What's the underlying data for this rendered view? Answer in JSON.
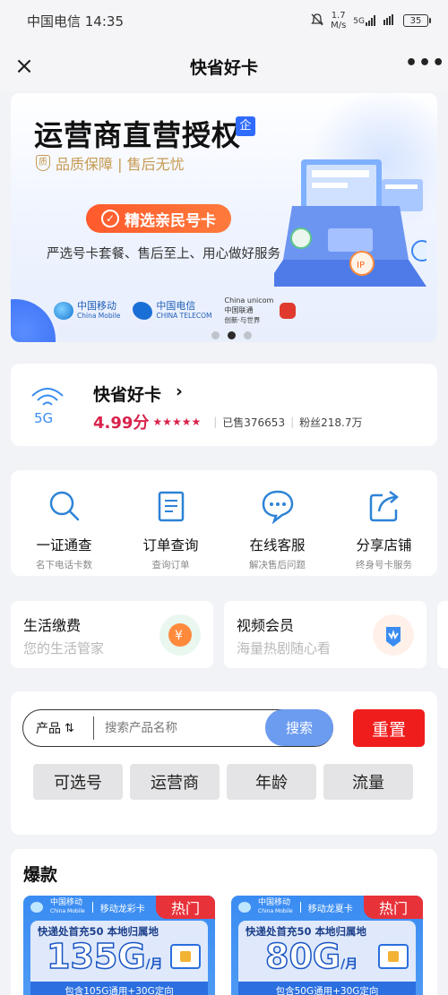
{
  "status_bar": {
    "carrier_time": "中国电信 14:35",
    "speed_value": "1.7",
    "speed_unit": "M/s",
    "signal": "5G",
    "battery": "35"
  },
  "nav": {
    "close_icon": "×",
    "title": "快省好卡",
    "more_icon": "•••"
  },
  "banner": {
    "title": "运营商直营授权",
    "badge": "企",
    "guarantee": "品质保障 | 售后无忧",
    "shield": "质",
    "pill_label": "精选亲民号卡",
    "description": "严选号卡套餐、售后至上、用心做好服务",
    "logos": [
      {
        "name": "中国移动",
        "sub": "China Mobile"
      },
      {
        "name": "中国电信",
        "sub": "CHINA TELECOM"
      },
      {
        "name": "China unicom中国联通",
        "sub": "创新·与世界"
      }
    ],
    "carousel_dots": 3,
    "active_dot": 1
  },
  "shop": {
    "name": "快省好卡",
    "arrow": "›",
    "score": "4.99分",
    "stars": "★★★★★",
    "sold": "已售376653",
    "fans": "粉丝218.7万"
  },
  "services": [
    {
      "title": "一证通查",
      "subtitle": "名下电话卡数",
      "icon": "search-icon"
    },
    {
      "title": "订单查询",
      "subtitle": "查询订单",
      "icon": "order-list-icon"
    },
    {
      "title": "在线客服",
      "subtitle": "解决售后问题",
      "icon": "chat-bubble-icon"
    },
    {
      "title": "分享店铺",
      "subtitle": "终身号卡服务",
      "icon": "share-icon"
    }
  ],
  "quick_cards": [
    {
      "title": "生活缴费",
      "subtitle": "您的生活管家",
      "icon": "payment-icon"
    },
    {
      "title": "视频会员",
      "subtitle": "海量热剧随心看",
      "icon": "video-vip-icon"
    }
  ],
  "search": {
    "product_label": "产品",
    "sort_icon": "⇅",
    "placeholder": "搜索产品名称",
    "search_button": "搜索",
    "reset_button": "重置",
    "filters": [
      "可选号",
      "运营商",
      "年龄",
      "流量"
    ]
  },
  "hot": {
    "title": "爆款",
    "products": [
      {
        "operator": "中国移动",
        "operator_en": "China Mobile",
        "series": "移动龙彩卡",
        "tag": "热门",
        "promo": "快递处首充50  本地归属地",
        "data": "135G",
        "unit": "/月",
        "footer": "包含105G通用+30G定向"
      },
      {
        "operator": "中国移动",
        "operator_en": "China Mobile",
        "series": "移动龙夏卡",
        "tag": "热门",
        "promo": "快递处首充50  本地归属地",
        "data": "80G",
        "unit": "/月",
        "footer": "包含50G通用+30G定向"
      }
    ]
  },
  "colors": {
    "accent_blue": "#2f6bff",
    "score_red": "#d8234b",
    "reset_red": "#f01d1d",
    "search_blue": "#6c9cf0"
  }
}
